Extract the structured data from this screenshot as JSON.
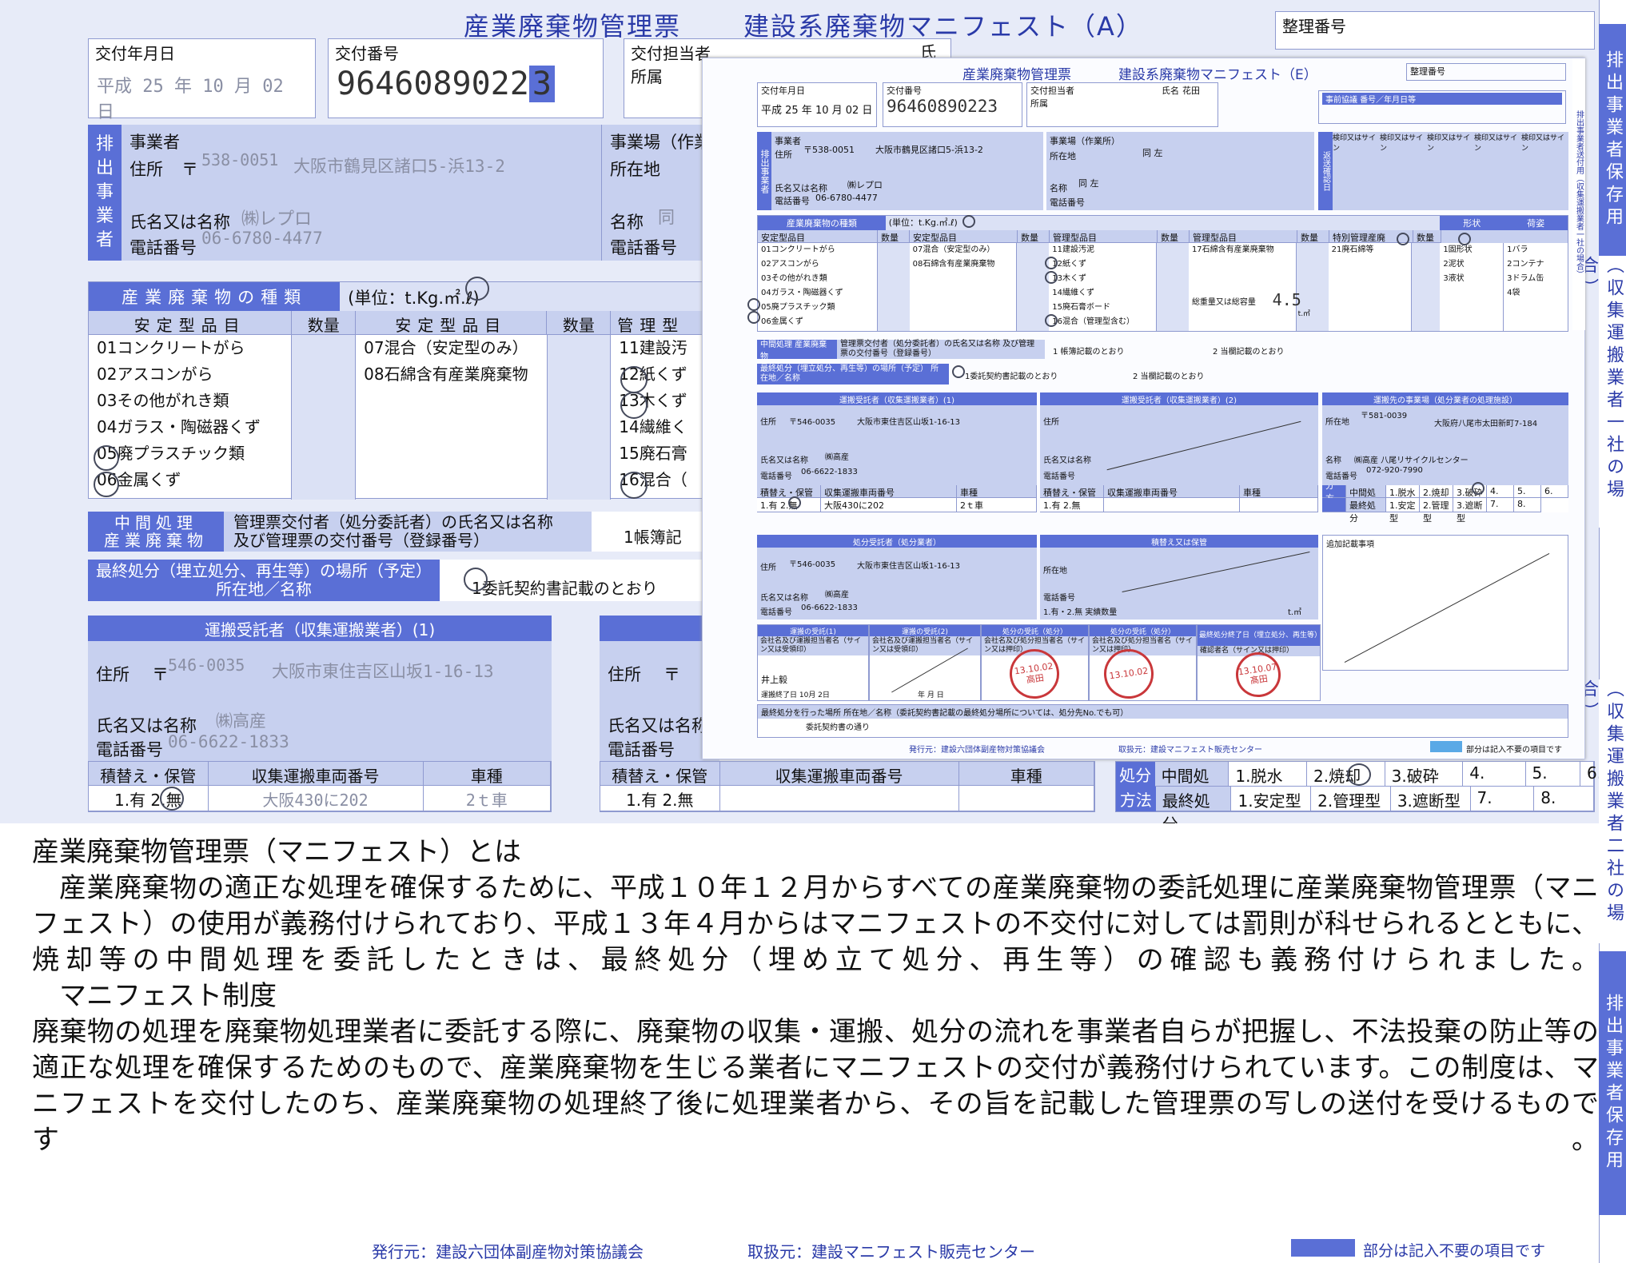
{
  "form_a": {
    "title_main": "産業廃棄物管理票",
    "title_sub": "建設系廃棄物マニフェスト（A）",
    "ref_label": "整理番号",
    "date_label": "交付年月日",
    "date_value": "平成 25 年 10 月 02 日",
    "num_label": "交付番号",
    "num_value": "9646089022",
    "num_last": "3",
    "staff_label": "交付担当者",
    "shozoku_label": "所属",
    "name_label": "氏名",
    "emitter_side": [
      "排",
      "出",
      "事",
      "業",
      "者"
    ],
    "biz_label": "事業者",
    "addr_label": "住所",
    "post_mark": "〒",
    "postal": "538-0051",
    "addr_value": "大阪市鶴見区諸口5-浜13-2",
    "name_or_label": "氏名又は名称",
    "company": "㈱レプロ",
    "tel_label": "電話番号",
    "tel": "06-6780-4477",
    "site_label": "事業場（作業",
    "site_addr_label": "所在地",
    "site_name_label": "名称",
    "site_same": "同",
    "site_tel_label": "電話番号",
    "types_header": "産業廃棄物の種類",
    "unit_text": "(単位：t.Kg.㎡.ℓ)",
    "col_stable": "安定型品目",
    "col_qty": "数量",
    "col_stable2": "安定型品目",
    "col_qty2": "数量",
    "col_mgmt": "管理型",
    "stable_items": [
      "01コンクリートがら",
      "02アスコンがら",
      "03その他がれき類",
      "04ガラス・陶磁器くず",
      "05廃プラスチック類",
      "06金属くず"
    ],
    "stable_items2": [
      "07混合（安定型のみ）",
      "08石綿含有産業廃棄物"
    ],
    "mgmt_items": [
      "11建設汚",
      "12紙くず",
      "13木くず",
      "14繊維く",
      "15廃石膏",
      "16混合（"
    ],
    "mid_title1": "中間処理",
    "mid_title2": "産業廃棄物",
    "mid_text1": "管理票交付者（処分委託者）の氏名又は名称",
    "mid_text2": "及び管理票の交付番号（登録番号）",
    "mid_opt": "1帳簿記",
    "final_label1": "最終処分（埋立処分、再生等）の場所（予定）",
    "final_label2": "所在地／名称",
    "final_opt": "1委託契約書記載のとおり",
    "trans1_header": "運搬受託者（収集運搬業者）(1)",
    "trans_addr_label": "住所",
    "trans_post_mark": "〒",
    "trans_postal": "546-0035",
    "trans_addr": "大阪市東住吉区山坂1-16-13",
    "trans_name_label": "氏名又は名称",
    "trans_company": "㈱高産",
    "trans_tel_label": "電話番号",
    "trans_tel": "06-6622-1833",
    "tt_label1": "積替え・保管",
    "tt_label2": "収集運搬車両番号",
    "tt_label3": "車種",
    "tt_opts": "1.有 2.無",
    "vehicle": "大阪430に202",
    "vtype": "2ｔ車",
    "trans2_addr_label": "住所",
    "trans2_post_mark": "〒",
    "trans2_name_label": "氏名又は名称",
    "trans2_tel_label": "電話番号",
    "tt2_label1": "積替え・保管",
    "tt2_label2": "収集運搬車両番号",
    "tt2_label3": "車種",
    "tt2_opts": "1.有 2.無",
    "method_l1": "処分",
    "method_l2": "方法",
    "method_mid": "中間処理",
    "method_final": "最終処分",
    "mid_ops": [
      "1.脱水",
      "2.焼却",
      "3.破砕",
      "4.",
      "5.",
      "6."
    ],
    "final_ops": [
      "1.安定型",
      "2.管理型",
      "3.遮断型",
      "7.",
      "8."
    ],
    "footer_pub": "発行元：建設六団体副産物対策協議会",
    "footer_dist": "取扱元：建設マニフェスト販売センター",
    "footer_note": "部分は記入不要の項目です",
    "side1": "排出事業者保存用",
    "side2": "（収集運搬業者一社の場合）",
    "side3": "（収集運搬業者二社の場合）",
    "side4": "排出事業者保存用"
  },
  "form_e": {
    "title_main": "産業廃棄物管理票",
    "title_sub": "建設系廃棄物マニフェスト（E）",
    "ref_label": "整理番号",
    "date_label": "交付年月日",
    "date_value": "平成 25 年 10 月 02 日",
    "num_label": "交付番号",
    "num_value": "96460890223",
    "staff_label": "交付担当者",
    "shozoku_label": "所属",
    "name_label": "氏名",
    "staff_name": "花田",
    "prior_label": "事前協議 番号／年月日等",
    "emitter_side": "排出事業者",
    "biz_label": "事業者",
    "addr_label": "住所",
    "postal": "〒538-0051",
    "addr_value": "大阪市鶴見区諸口5-浜13-2",
    "name_or_label": "氏名又は名称",
    "company": "㈱レプロ",
    "tel_label": "電話番号",
    "tel": "06-6780-4477",
    "site_label": "事業場（作業所）",
    "site_addr_label": "所在地",
    "site_addr": "同 左",
    "site_name_label": "名称",
    "site_name": "同 左",
    "site_tel_label": "電話番号",
    "return_side": "返送確認日",
    "return_cols": [
      "検印又はサイン",
      "検印又はサイン",
      "検印又はサイン",
      "検印又はサイン",
      "検印又はサイン"
    ],
    "types_header": "産業廃棄物の種類",
    "unit_text": "(単位：t.Kg.㎡.ℓ)",
    "hdr_cols": [
      "安定型品目",
      "数量",
      "安定型品目",
      "数量",
      "管理型品目",
      "数量",
      "管理型品目",
      "数量",
      "特別管理産廃",
      "数量"
    ],
    "col1": [
      "01コンクリートがら",
      "02アスコンがら",
      "03その他がれき類",
      "04ガラス・陶磁器くず",
      "05廃プラスチック類",
      "06金属くず"
    ],
    "col2": [
      "07混合（安定型のみ）",
      "08石綿含有産業廃棄物"
    ],
    "col3": [
      "11建設汚泥",
      "12紙くず",
      "13木くず",
      "14繊維くず",
      "15廃石膏ボード",
      "16混合（管理型含む）"
    ],
    "col4": [
      "17石綿含有産業廃棄物"
    ],
    "col5": [
      "21廃石綿等"
    ],
    "total_label": "総重量又は総容量",
    "total_value": "4.5",
    "total_unit": "t.㎥",
    "shape_label": "形状",
    "shapes": [
      "1固形状",
      "2泥状",
      "3液状"
    ],
    "pack_label": "荷姿",
    "packs": [
      "1バラ",
      "2コンテナ",
      "3ドラム缶",
      "4袋"
    ],
    "mid_label": "中間処理 産業廃棄物",
    "mid_text": "管理票交付者（処分委託者）の氏名又は名称 及び管理票の交付番号（登録番号）",
    "mid_opt1": "1 帳簿記載のとおり",
    "mid_opt2": "2 当欄記載のとおり",
    "final_label": "最終処分（埋立処分、再生等）の場所（予定） 所在地／名称",
    "final_opt1": "1委託契約書記載のとおり",
    "final_opt2": "2 当欄記載のとおり",
    "t1_header": "運搬受託者（収集運搬業者）(1)",
    "t1_addr_label": "住所",
    "t1_postal": "〒546-0035",
    "t1_addr": "大阪市東住吉区山坂1-16-13",
    "t1_name_label": "氏名又は名称",
    "t1_company": "㈱高産",
    "t1_tel_label": "電話番号",
    "t1_tel": "06-6622-1833",
    "t1_sub": [
      "積替え・保管",
      "収集運搬車両番号",
      "車種"
    ],
    "t1_opts": "1.有 2.無",
    "t1_vehicle": "大阪430に202",
    "t1_vtype": "2ｔ車",
    "t2_header": "運搬受託者（収集運搬業者）(2)",
    "t2_addr_label": "住所",
    "t2_name_label": "氏名又は名称",
    "t2_tel_label": "電話番号",
    "t2_sub": [
      "積替え・保管",
      "収集運搬車両番号",
      "車種"
    ],
    "t2_opts": "1.有 2.無",
    "t3_header": "運搬先の事業場（処分業者の処理施設）",
    "t3_addr_label": "所在地",
    "t3_postal": "〒581-0039",
    "t3_addr": "大阪府八尾市太田新町7-184",
    "t3_name_label": "名称",
    "t3_company": "㈱高産 八尾リサイクルセンター",
    "t3_tel_label": "電話番号",
    "t3_tel": "072-920-7990",
    "method_l": "処分方法",
    "method_mid": "中間処理",
    "method_final": "最終処分",
    "mid_ops": [
      "1.脱水",
      "2.焼却",
      "3.破砕",
      "4.",
      "5.",
      "6."
    ],
    "final_ops": [
      "1.安定型",
      "2.管理型",
      "3.遮断型",
      "7.",
      "8."
    ],
    "d_header": "処分受託者（処分業者）",
    "d_addr_label": "住所",
    "d_postal": "〒546-0035",
    "d_addr": "大阪市東住吉区山坂1-16-13",
    "d_name_label": "氏名又は名称",
    "d_company": "㈱高産",
    "d_tel_label": "電話番号",
    "d_tel": "06-6622-1833",
    "s_header": "積替え又は保管",
    "s_addr_label": "所在地",
    "s_tel_label": "電話番号",
    "s_opts": "1.有・2.無 実績数量",
    "s_unit": "t.㎥",
    "extra_header": "追加記載事項",
    "r1": "運搬の受託(1)",
    "r2": "運搬の受託(2)",
    "r3": "処分の受託（処分）",
    "r4": "処分の受託（処分）",
    "r5": "最終処分終了日（埋立処分、再生等）",
    "r_sub": "会社名及び運搬担当者名（サイン又は受領印）",
    "r_sub2": "会社名及び処分担当者名（サイン又は押印）",
    "r5_sub": "確認者名（サイン又は押印）",
    "sign1": "井上毅",
    "date_r1": "運搬終了日 10月 2日",
    "date_note": "年 月 日",
    "seal1_l1": "13.10.02",
    "seal1_l2": "高田",
    "seal2_l1": "13.10.02",
    "seal3_l1": "13.10.07",
    "seal3_l2": "髙田",
    "final_done": "最終処分を行った場所 所在地／名称（委託契約書記載の最終処分場所については、処分先No.でも可）",
    "final_done_val": "委託契約書の通り",
    "footer_pub": "発行元：建設六団体副産物対策協議会",
    "footer_dist": "取扱元：建設マニフェスト販売センター",
    "footer_note": "部分は記入不要の項目です",
    "side": "排出事業者送付用（収集運搬業者一社の場合）"
  },
  "explanation": {
    "heading": "産業廃棄物管理票（マニフェスト）とは",
    "p1": "産業廃棄物の適正な処理を確保するために、平成１０年１２月からすべての産業廃棄物の委託処理に産業廃棄物管理票（マニフェスト）の使用が義務付けられており、平成１３年４月からはマニフェストの不交付に対しては罰則が科せられるとともに、焼却等の中間処理を委託したときは、最終処分（埋め立て処分、再生等）の確認も義務付けられました。",
    "subheading": "マニフェスト制度",
    "p2": "廃棄物の処理を廃棄物処理業者に委託する際に、廃棄物の収集・運搬、処分の流れを事業者自らが把握し、不法投棄の防止等の適正な処理を確保するためのもので、産業廃棄物を生じる業者にマニフェストの交付が義務付けられています。この制度は、マニフェストを交付したのち、産業廃棄物の処理終了後に処理業者から、その旨を記載した管理票の写しの送付を受けるものです。"
  }
}
